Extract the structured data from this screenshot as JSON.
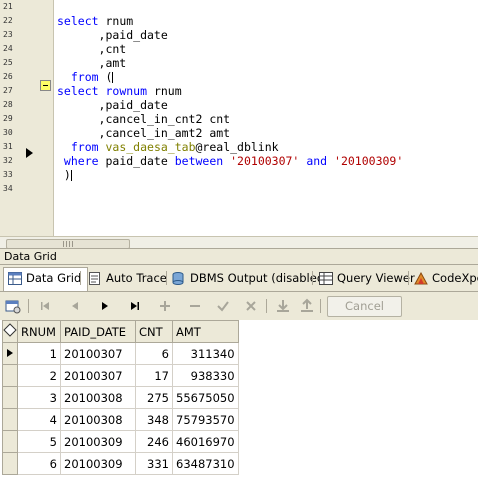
{
  "editor": {
    "line_numbers": [
      "21",
      "22",
      "23",
      "24",
      "25",
      "26",
      "27",
      "28",
      "29",
      "30",
      "31",
      "32",
      "33",
      "34"
    ],
    "code_lines": [
      [],
      [
        {
          "t": "select",
          "c": "kw"
        },
        {
          "t": " rnum",
          "c": "id"
        }
      ],
      [
        {
          "t": "      ,paid_date",
          "c": "id"
        }
      ],
      [
        {
          "t": "      ,cnt",
          "c": "id"
        }
      ],
      [
        {
          "t": "      ,amt",
          "c": "id"
        }
      ],
      [
        {
          "t": "  from",
          "c": "kw"
        },
        {
          "t": " (",
          "c": "id"
        }
      ],
      [
        {
          "t": "select",
          "c": "kw"
        },
        {
          "t": " ",
          "c": "id"
        },
        {
          "t": "rownum",
          "c": "kw"
        },
        {
          "t": " rnum",
          "c": "id"
        }
      ],
      [
        {
          "t": "      ,paid_date",
          "c": "id"
        }
      ],
      [
        {
          "t": "      ,cancel_in_cnt2 cnt",
          "c": "id"
        }
      ],
      [
        {
          "t": "      ,cancel_in_amt2 amt",
          "c": "id"
        }
      ],
      [
        {
          "t": "  from",
          "c": "kw"
        },
        {
          "t": " ",
          "c": "id"
        },
        {
          "t": "vas_daesa_tab",
          "c": "tbl"
        },
        {
          "t": "@real_dblink",
          "c": "id"
        }
      ],
      [
        {
          "t": " where",
          "c": "kw"
        },
        {
          "t": " paid_date ",
          "c": "id"
        },
        {
          "t": "between",
          "c": "kw"
        },
        {
          "t": " ",
          "c": "id"
        },
        {
          "t": "'20100307'",
          "c": "str"
        },
        {
          "t": " ",
          "c": "id"
        },
        {
          "t": "and",
          "c": "kw"
        },
        {
          "t": " ",
          "c": "id"
        },
        {
          "t": "'20100309'",
          "c": "str"
        }
      ],
      [
        {
          "t": " )",
          "c": "id"
        }
      ],
      []
    ]
  },
  "panel": {
    "title": "Data Grid"
  },
  "tabs": [
    {
      "label": "Data Grid",
      "icon": "grid-icon",
      "active": true
    },
    {
      "label": "Auto Trace",
      "icon": "trace-icon",
      "active": false
    },
    {
      "label": "DBMS Output (disabled)",
      "icon": "dbms-output-icon",
      "active": false
    },
    {
      "label": "Query Viewer",
      "icon": "query-viewer-icon",
      "active": false
    },
    {
      "label": "CodeXpert",
      "icon": "codexpert-icon",
      "active": false
    }
  ],
  "toolbar": {
    "cancel_label": "Cancel"
  },
  "grid": {
    "columns": [
      "RNUM",
      "PAID_DATE",
      "CNT",
      "AMT"
    ],
    "rows": [
      [
        "1",
        "20100307",
        "6",
        "311340"
      ],
      [
        "2",
        "20100307",
        "17",
        "938330"
      ],
      [
        "3",
        "20100308",
        "275",
        "55675050"
      ],
      [
        "4",
        "20100308",
        "348",
        "75793570"
      ],
      [
        "5",
        "20100309",
        "246",
        "46016970"
      ],
      [
        "6",
        "20100309",
        "331",
        "63487310"
      ]
    ],
    "current_row": 0
  },
  "colors": {
    "keyword": "#0000ff",
    "string": "#b00000",
    "table_name": "#808000",
    "chrome": "#ece9d8"
  }
}
